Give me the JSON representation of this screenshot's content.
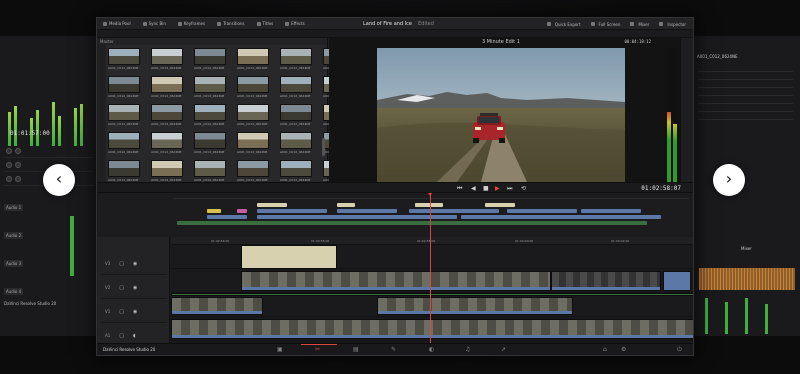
{
  "topbar": {
    "tabs": [
      "Media Pool",
      "Sync Bin",
      "Keyframes",
      "Transitions",
      "Titles",
      "Effects"
    ],
    "project_title": "Land of Fire and Ice",
    "project_state": "Edited",
    "right_tabs": [
      "Quick Export",
      "Full Screen",
      "Mixer",
      "Inspector"
    ]
  },
  "media_pool": {
    "header": "Master",
    "clip_label": "A001_C012_0624NE"
  },
  "viewer": {
    "timeline_name": "3 Minute Edit 1",
    "source_timecode": "00:04:18:12"
  },
  "transport": {
    "timecode": "01:02:58:07",
    "buttons": [
      "⏮",
      "◀",
      "■",
      "▶",
      "⏭",
      "⟲"
    ]
  },
  "ruler_marks": [
    "01:02:54:00",
    "01:02:56:00",
    "01:02:58:00",
    "01:03:00:00",
    "01:03:02:00"
  ],
  "track_headers": [
    {
      "label": "V3"
    },
    {
      "label": "V2"
    },
    {
      "label": "V1"
    },
    {
      "label": "A1"
    }
  ],
  "left_panel": {
    "timecode": "01:01:57:00",
    "audio_labels": [
      "Audio 1",
      "Audio 2",
      "Audio 3",
      "Audio 4"
    ],
    "brand": "DaVinci Resolve Studio 20"
  },
  "right_panel": {
    "header": "A001_C012_0624NE",
    "mixer_label": "Mixer"
  },
  "pagebar": {
    "brand": "DaVinci Resolve Studio 20",
    "pages": [
      "media-icon",
      "cut-icon",
      "edit-icon",
      "fusion-icon",
      "color-icon",
      "fairlight-icon",
      "deliver-icon"
    ]
  },
  "nav": {
    "prev": "‹",
    "next": "›"
  },
  "colors": {
    "accent_red": "#e0443c",
    "clip_blue": "#5b78a6",
    "clip_green": "#3b6e3e",
    "title_clip": "#d8d1b0"
  }
}
